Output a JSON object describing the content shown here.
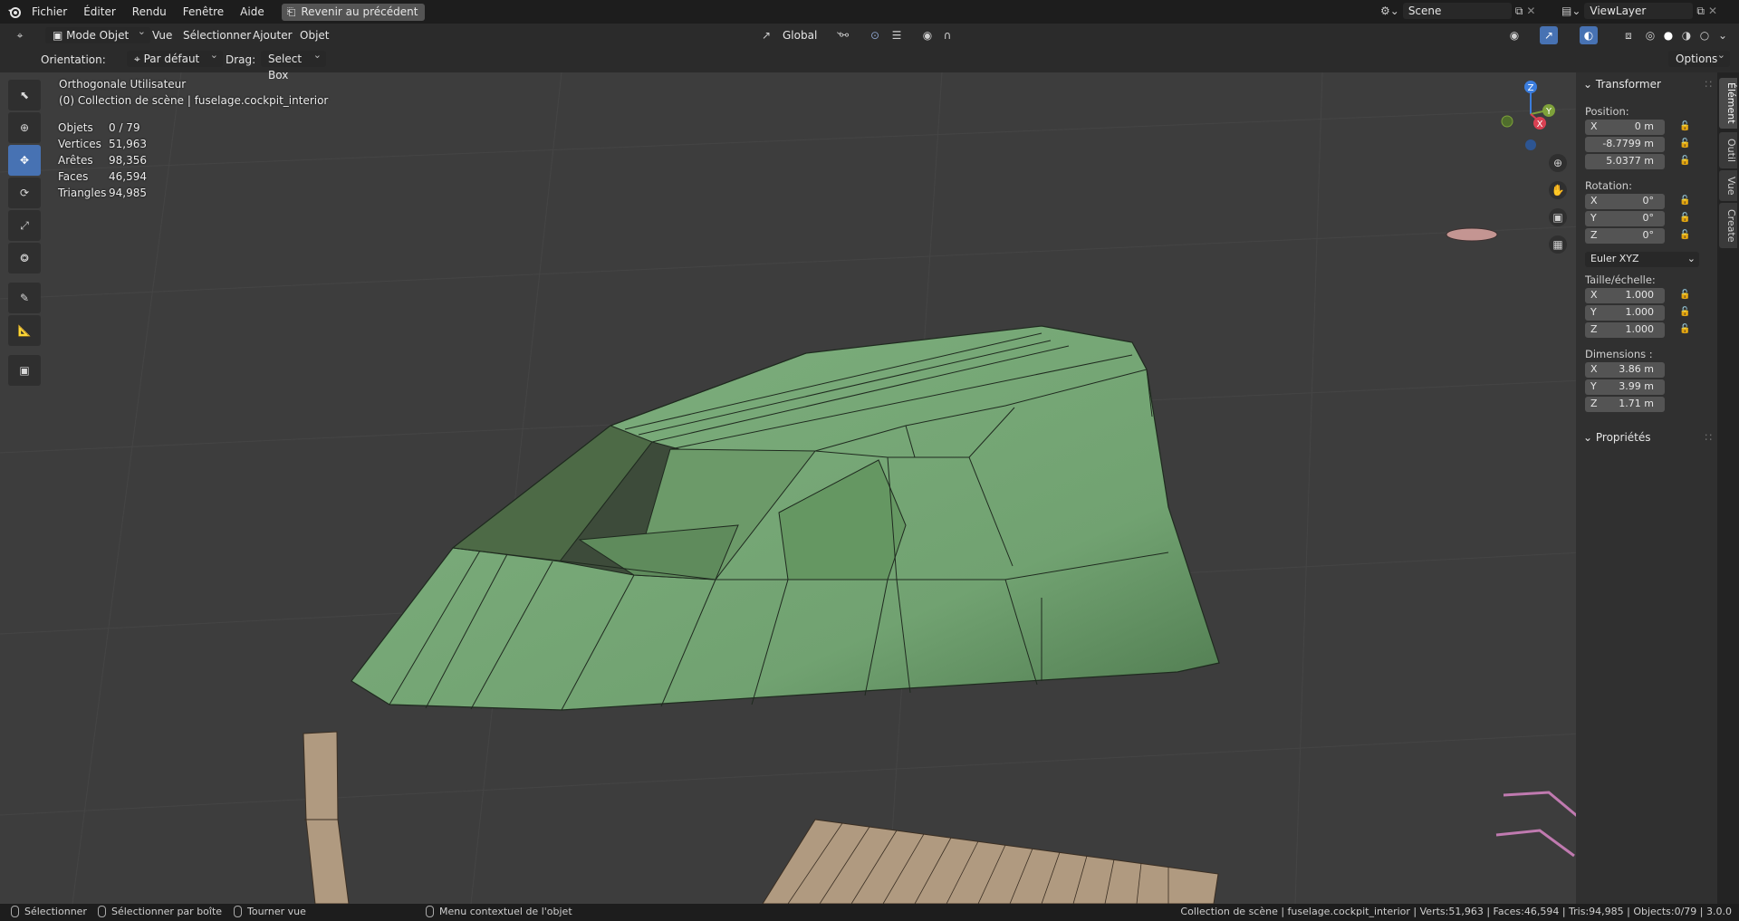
{
  "topbar": {
    "menus": [
      "Fichier",
      "Éditer",
      "Rendu",
      "Fenêtre",
      "Aide"
    ],
    "revert_label": "Revenir au précédent",
    "scene": "Scene",
    "view_layer": "ViewLayer"
  },
  "header": {
    "mode": "Mode Objet",
    "menus": [
      "Vue",
      "Sélectionner",
      "Ajouter",
      "Objet"
    ],
    "transform_orientation": "Global",
    "options": "Options"
  },
  "toolsettings": {
    "orientation_label": "Orientation:",
    "orientation_value": "Par défaut",
    "drag_label": "Drag:",
    "drag_value": "Select Box"
  },
  "viewport": {
    "view_name": "Orthogonale Utilisateur",
    "collection": "(0) Collection de scène | fuselage.cockpit_interior",
    "stats": [
      {
        "label": "Objets",
        "value": "0 / 79"
      },
      {
        "label": "Vertices",
        "value": "51,963"
      },
      {
        "label": "Arêtes",
        "value": "98,356"
      },
      {
        "label": "Faces",
        "value": "46,594"
      },
      {
        "label": "Triangles",
        "value": "94,985"
      }
    ],
    "gizmo": {
      "z": "Z",
      "y": "Y",
      "x": "X"
    }
  },
  "npanel": {
    "transform_title": "Transformer",
    "position_label": "Position:",
    "position": [
      {
        "axis": "X",
        "value": "0 m"
      },
      {
        "axis": "",
        "value": "-8.7799 m"
      },
      {
        "axis": "",
        "value": "5.0377 m"
      }
    ],
    "rotation_label": "Rotation:",
    "rotation": [
      {
        "axis": "X",
        "value": "0°"
      },
      {
        "axis": "Y",
        "value": "0°"
      },
      {
        "axis": "Z",
        "value": "0°"
      }
    ],
    "rotation_mode": "Euler XYZ",
    "scale_label": "Taille/échelle:",
    "scale": [
      {
        "axis": "X",
        "value": "1.000"
      },
      {
        "axis": "Y",
        "value": "1.000"
      },
      {
        "axis": "Z",
        "value": "1.000"
      }
    ],
    "dimensions_label": "Dimensions :",
    "dimensions": [
      {
        "axis": "X",
        "value": "3.86 m"
      },
      {
        "axis": "Y",
        "value": "3.99 m"
      },
      {
        "axis": "Z",
        "value": "1.71 m"
      }
    ],
    "properties_title": "Propriétés",
    "tabs": [
      "Élément",
      "Outil",
      "Vue",
      "Create"
    ]
  },
  "statusbar": {
    "select": "Sélectionner",
    "box_select": "Sélectionner par boîte",
    "rotate": "Tourner vue",
    "context_menu": "Menu contextuel de l'objet",
    "info": "Collection de scène | fuselage.cockpit_interior | Verts:51,963 | Faces:46,594 | Tris:94,985 | Objects:0/79 | 3.0.0"
  },
  "colors": {
    "cockpit": "#78a978",
    "accent": "#4772b3",
    "wood": "#b09a80",
    "pink": "#c07ab0"
  }
}
